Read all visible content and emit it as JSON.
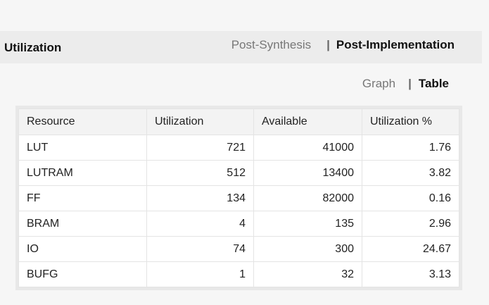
{
  "header": {
    "title": "Utilization",
    "modes": [
      {
        "label": "Post-Synthesis",
        "active": false
      },
      {
        "label": "Post-Implementation",
        "active": true
      }
    ]
  },
  "view": {
    "options": [
      {
        "label": "Graph",
        "active": false
      },
      {
        "label": "Table",
        "active": true
      }
    ]
  },
  "table": {
    "columns": [
      "Resource",
      "Utilization",
      "Available",
      "Utilization %"
    ],
    "rows": [
      {
        "resource": "LUT",
        "utilization": "721",
        "available": "41000",
        "percent": "1.76"
      },
      {
        "resource": "LUTRAM",
        "utilization": "512",
        "available": "13400",
        "percent": "3.82"
      },
      {
        "resource": "FF",
        "utilization": "134",
        "available": "82000",
        "percent": "0.16"
      },
      {
        "resource": "BRAM",
        "utilization": "4",
        "available": "135",
        "percent": "2.96"
      },
      {
        "resource": "IO",
        "utilization": "74",
        "available": "300",
        "percent": "24.67"
      },
      {
        "resource": "BUFG",
        "utilization": "1",
        "available": "32",
        "percent": "3.13"
      }
    ]
  }
}
